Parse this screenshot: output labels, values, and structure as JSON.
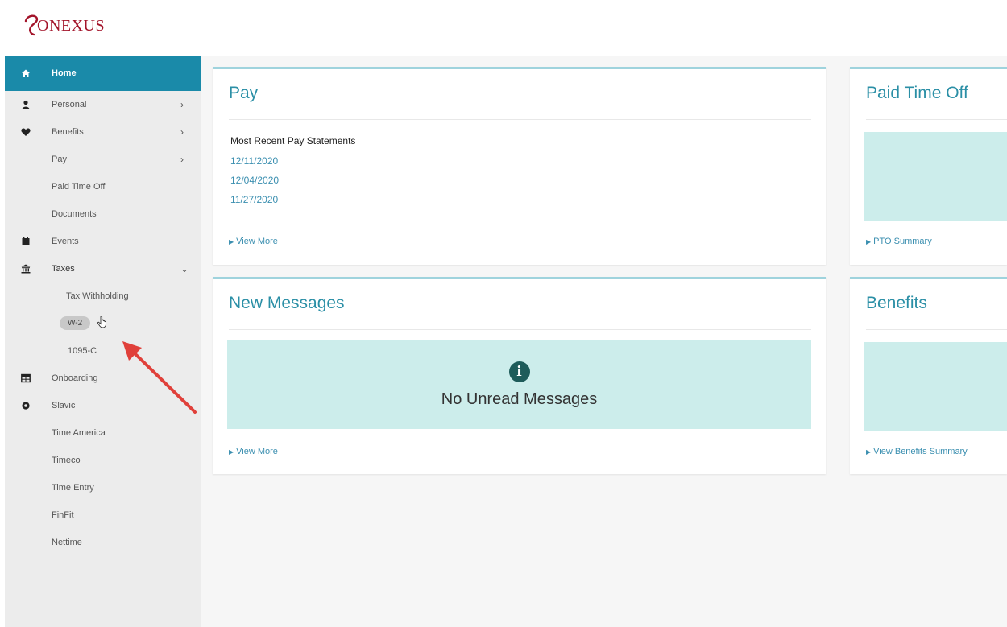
{
  "brand": {
    "logo_text": "ONEXUS"
  },
  "sidebar": {
    "items": [
      {
        "label": "Home",
        "icon": "home-icon"
      },
      {
        "label": "Personal",
        "icon": "person-icon"
      },
      {
        "label": "Benefits",
        "icon": "heart-icon"
      },
      {
        "label": "Pay"
      },
      {
        "label": "Paid Time Off"
      },
      {
        "label": "Documents"
      },
      {
        "label": "Events",
        "icon": "calendar-icon"
      },
      {
        "label": "Taxes",
        "icon": "bank-icon"
      },
      {
        "label": "Tax Withholding"
      },
      {
        "label": "W-2"
      },
      {
        "label": "1095-C"
      },
      {
        "label": "Onboarding",
        "icon": "table-icon"
      },
      {
        "label": "Slavic",
        "icon": "gear-icon"
      },
      {
        "label": "Time America"
      },
      {
        "label": "Timeco"
      },
      {
        "label": "Time Entry"
      },
      {
        "label": "FinFit"
      },
      {
        "label": "Nettime"
      }
    ],
    "chevron_right": "›",
    "chevron_down": "⌄"
  },
  "pay_card": {
    "title": "Pay",
    "subtitle": "Most Recent Pay Statements",
    "statements": [
      "12/11/2020",
      "12/04/2020",
      "11/27/2020"
    ],
    "view_more": "View More"
  },
  "pto_card": {
    "title": "Paid Time Off",
    "link": "PTO Summary"
  },
  "messages_card": {
    "title": "New Messages",
    "empty_text": "No Unread Messages",
    "info_glyph": "i",
    "view_more": "View More"
  },
  "benefits_card": {
    "title": "Benefits",
    "link": "View Benefits Summary"
  },
  "colors": {
    "accent": "#1a8aa9",
    "title": "#2b8fa6",
    "link": "#3b8fb0",
    "panel": "#ccedeb",
    "brand": "#a3142a",
    "arrow": "#e0403a"
  }
}
